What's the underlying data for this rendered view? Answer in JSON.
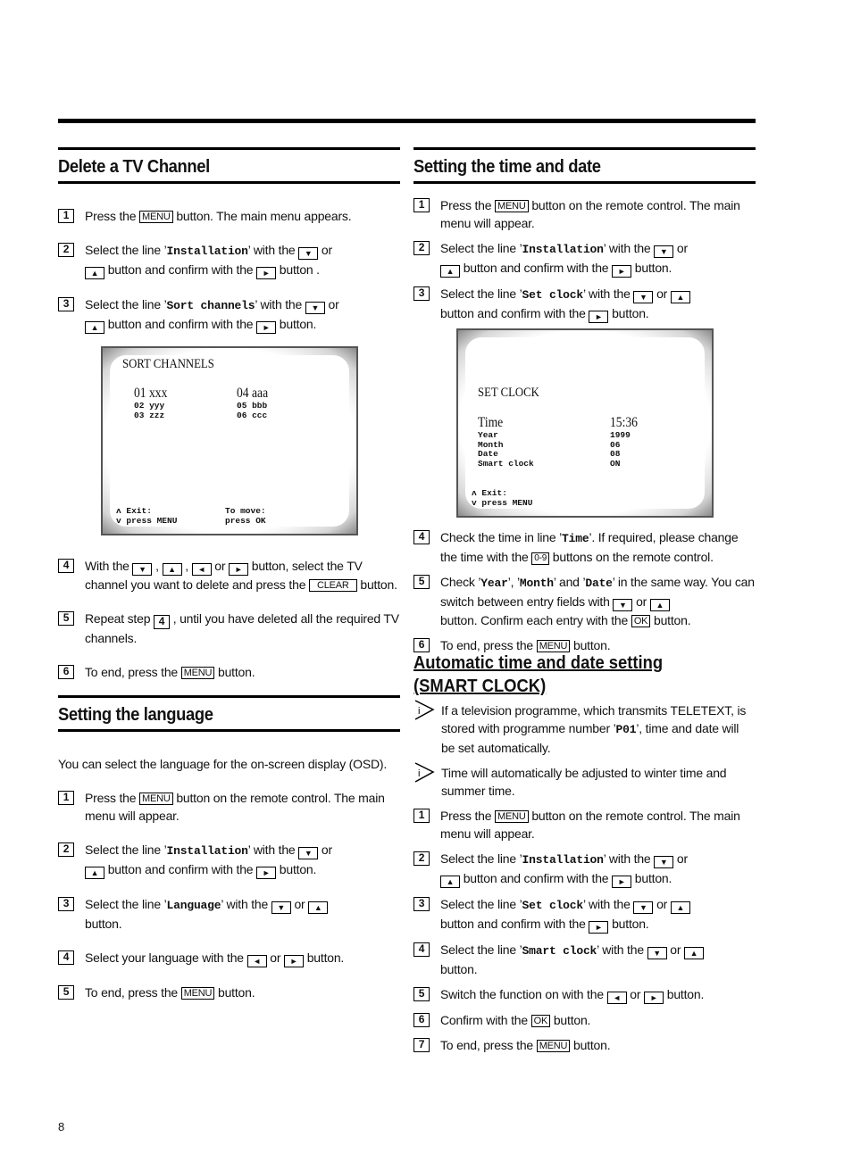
{
  "page_number": "8",
  "delete_channel": {
    "title": "Delete a TV Channel",
    "steps": [
      {
        "n": "1",
        "a": "Press the ",
        "k1": "MENU",
        "b": " button. The main menu appears."
      },
      {
        "n": "2",
        "a": "Select the line ’",
        "m": "Installation",
        "b": "’ with the ",
        "c": " or",
        "d": " button and confirm with the ",
        "e": " button ."
      },
      {
        "n": "3",
        "a": "Select the line ’",
        "m": "Sort channels",
        "b": "’ with the ",
        "c": " or",
        "d": " button and confirm with the ",
        "e": " button."
      },
      {
        "n": "4",
        "a": "With the ",
        "s1": " , ",
        "s2": " , ",
        "s3": " or ",
        "b": " button, select the TV channel you want to delete and press the ",
        "k1": "CLEAR",
        "c": " button."
      },
      {
        "n": "5",
        "a": "Repeat step ",
        "ref": "4",
        "b": " ,  until you have deleted all the required TV channels."
      },
      {
        "n": "6",
        "a": "To end, press the ",
        "k1": "MENU",
        "b": " button."
      }
    ],
    "screen": {
      "title": "SORT CHANNELS",
      "big_left": "01 xxx",
      "big_right": "04 aaa",
      "small_left": "02 yyy\n03 zzz",
      "small_right": "05 bbb\n06 ccc",
      "footer_left": "ʌ Exit:\nv press MENU",
      "footer_right": "To move:\npress OK"
    }
  },
  "language": {
    "title": "Setting the language",
    "intro": "You can select the language for the on-screen display (OSD).",
    "steps": [
      {
        "n": "1",
        "a": "Press the ",
        "k1": "MENU",
        "b": " button on the remote control. The main menu will appear."
      },
      {
        "n": "2",
        "a": "Select the line ’",
        "m": "Installation",
        "b": "’ with the ",
        "c": " or",
        "d": " button and confirm with the ",
        "e": " button."
      },
      {
        "n": "3",
        "a": "Select the line ’",
        "m": "Language",
        "b": "’ with the ",
        "c": " or ",
        "d": " button."
      },
      {
        "n": "4",
        "a": "Select your language with the ",
        "b": " or ",
        "c": " button."
      },
      {
        "n": "5",
        "a": "To end, press the ",
        "k1": "MENU",
        "b": " button."
      }
    ]
  },
  "time_date": {
    "title": "Setting the time and date",
    "steps": [
      {
        "n": "1",
        "a": "Press the ",
        "k1": "MENU",
        "b": " button on the remote control. The main menu will appear."
      },
      {
        "n": "2",
        "a": "Select the line ’",
        "m": "Installation",
        "b": "’ with the ",
        "c": " or",
        "d": " button and confirm with the ",
        "e": " button."
      },
      {
        "n": "3",
        "a": "Select the line ’",
        "m": "Set clock",
        "b": "’ with the ",
        "c": " or ",
        "d": " button and confirm with the ",
        "e": " button."
      },
      {
        "n": "4",
        "a": "Check the time in line ’",
        "m": "Time",
        "b": "’. If required, please change the time with the ",
        "k1": "0-9",
        "c": " buttons on the remote control."
      },
      {
        "n": "5",
        "a": "Check ’",
        "m1": "Year",
        "b": "’, ’",
        "m2": "Month",
        "c": "’ and ’",
        "m3": "Date",
        "d": "’ in the same way. You can switch between entry fields with ",
        "e": " or ",
        "f": " button. Confirm each entry with the ",
        "k1": "OK",
        "g": " button."
      },
      {
        "n": "6",
        "a": "To end, press the ",
        "k1": "MENU",
        "b": " button."
      }
    ],
    "screen": {
      "title": "SET CLOCK",
      "time_label": "Time",
      "time_value": "15:36",
      "labels": "Year\nMonth\nDate\nSmart clock",
      "values": "1999\n06\n08\nON",
      "footer": "ʌ Exit:\nv press MENU"
    }
  },
  "smart_clock": {
    "title_line1": "Automatic time and date setting",
    "title_line2": "(SMART CLOCK)",
    "notes": [
      {
        "a": "If a television programme, which transmits TELETEXT, is stored with programme number ’",
        "m": "P01",
        "b": "’, time and date will be set automatically."
      },
      {
        "a": "Time will automatically be adjusted to winter time and summer time."
      }
    ],
    "steps": [
      {
        "n": "1",
        "a": "Press the ",
        "k1": "MENU",
        "b": " button on the remote control. The main menu will appear."
      },
      {
        "n": "2",
        "a": "Select the line ’",
        "m": "Installation",
        "b": "’ with the ",
        "c": " or",
        "d": " button and confirm with the ",
        "e": " button."
      },
      {
        "n": "3",
        "a": "Select the line ’",
        "m": "Set clock",
        "b": "’ with the ",
        "c": " or ",
        "d": " button and confirm with the ",
        "e": " button."
      },
      {
        "n": "4",
        "a": "Select the line ’",
        "m": "Smart clock",
        "b": "’ with the ",
        "c": " or ",
        "d": " button."
      },
      {
        "n": "5",
        "a": "Switch the function on with the ",
        "b": " or ",
        "c": " button."
      },
      {
        "n": "6",
        "a": "Confirm with the ",
        "k1": "OK",
        "b": " button."
      },
      {
        "n": "7",
        "a": "To end, press the ",
        "k1": "MENU",
        "b": " button."
      }
    ]
  },
  "icons": {
    "down": "▼",
    "up": "▲",
    "left": "◄",
    "right": "►"
  }
}
